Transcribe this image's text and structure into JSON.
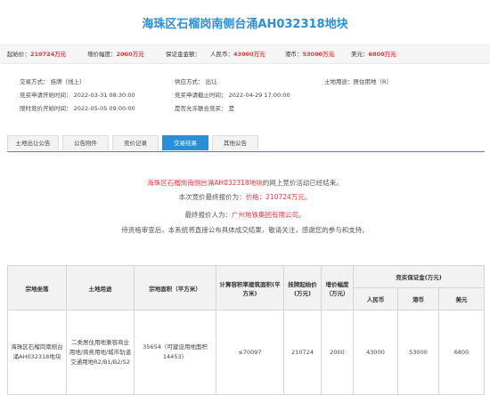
{
  "title": "海珠区石榴岗南侧台涌AH032318地块",
  "price_bar": {
    "start_price_label": "起始价：",
    "start_price_value": "210724万元",
    "increment_label": "增价幅度：",
    "increment_value": "2000万元",
    "deposit_label": "保证金金额：",
    "rmb_label": "人民币：",
    "rmb_value": "43000万元",
    "hkd_label": "港币：",
    "hkd_value": "53000万元",
    "usd_label": "美元：",
    "usd_value": "6800万元"
  },
  "info": {
    "trade_method": "交易方式：  挂牌（线上）",
    "supply_method": "供应方式：  出让",
    "land_use": "土地用途：居住用地（R）",
    "apply_start": "竞买申请开始时间：  2022-03-31 08:30:00",
    "apply_end": "竞买申请截止时间：  2022-04-29 17:00:00",
    "bid_start": "限时竞价开始时间：  2022-05-05 09:00:00",
    "joint_bid": "是否允许联合竞买：  是"
  },
  "tabs": [
    "土地出让公告",
    "公告附件",
    "竞价记录",
    "交易结果",
    "其他公告"
  ],
  "result": {
    "line1_name": "海珠区石榴岗南侧台涌AH032318地块",
    "line1_rest": "的网上竞价活动已经结束。",
    "line2_pre": "本次竞价最终报价为：",
    "line2_price": "价格：210724万元",
    "line2_post": "。",
    "line3_pre": "最终报价人为：",
    "line3_name": "广州地铁集团有限公司",
    "line3_post": "。",
    "line4": "待资格审查后，本系统将直接公布具体成交结果，敬请关注，感谢您的参与和支持。"
  },
  "table": {
    "headers": {
      "name": "宗地坐落",
      "use": "土地用途",
      "area": "宗地面积（平方米）",
      "floor_area": "计算容积率建筑面积(平方米)",
      "start_price": "挂牌起始价(万元)",
      "increment": "增价幅度（万元）",
      "deposit": "竞买保证金(万元)",
      "rmb": "人民币",
      "hkd": "港币",
      "usd": "美元"
    },
    "row": {
      "name": "海珠区石榴岗南侧台涌AH032318地块",
      "use": "二类居住用地兼容商业用地/商务用地/城市轨道交通用地R2/B1/B2/S2",
      "area": "35654（可建设用地面积14453）",
      "floor_area": "≤70097",
      "start_price": "210724",
      "increment": "2000",
      "rmb": "43000",
      "hkd": "53000",
      "usd": "6800"
    }
  }
}
